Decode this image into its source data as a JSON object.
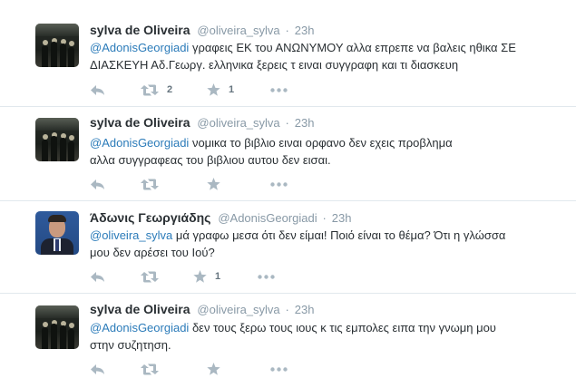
{
  "tweets": [
    {
      "author_name": "sylva de Oliveira",
      "author_handle": "@oliveira_sylva",
      "time": "23h",
      "mention": "@AdonisGeorgiadi",
      "text_rest": " γραφεις ΕΚ του ΑΝΩΝΥΜΟΥ αλλα επρεπε να βαλεις ηθικα ΣΕ ΔΙΑΣΚΕΥΗ Αδ.Γεωργ. ελληνικα ξερεις τ ειναι συγγραφη και τι διασκευη",
      "retweets": "2",
      "favorites": "1",
      "avatar": "dark-group-photo"
    },
    {
      "author_name": "sylva de Oliveira",
      "author_handle": "@oliveira_sylva",
      "time": "23h",
      "mention": "@AdonisGeorgiadi",
      "text_rest": " νομικα το βιβλιο ειναι ορφανο δεν εχεις προβλημα αλλα συγγραφεας του βιβλιου αυτου δεν εισαι.",
      "retweets": "",
      "favorites": "",
      "avatar": "dark-group-photo"
    },
    {
      "author_name": "Άδωνις Γεωργιάδης",
      "author_handle": "@AdonisGeorgiadi",
      "time": "23h",
      "mention": "@oliveira_sylva",
      "text_rest": " μά γραφω μεσα ότι δεν είμαι! Ποιό είναι το θέμα? Ότι η γλώσσα μου δεν αρέσει του Ιού?",
      "retweets": "",
      "favorites": "1",
      "avatar": "portrait-blue"
    },
    {
      "author_name": "sylva de Oliveira",
      "author_handle": "@oliveira_sylva",
      "time": "23h",
      "mention": "@AdonisGeorgiadi",
      "text_rest": " δεν τους ξερω τους ιους κ τις εμπολες ειπα την γνωμη μου στην συζητηση.",
      "retweets": "",
      "favorites": "",
      "avatar": "dark-group-photo"
    }
  ],
  "icons": {
    "reply": "reply-icon",
    "retweet": "retweet-icon",
    "favorite": "star-icon",
    "more": "more-icon"
  },
  "colors": {
    "link": "#2b7bb9",
    "muted": "#8899a6",
    "border": "#e1e8ed",
    "text": "#292f33",
    "icon": "#aab8c2"
  }
}
